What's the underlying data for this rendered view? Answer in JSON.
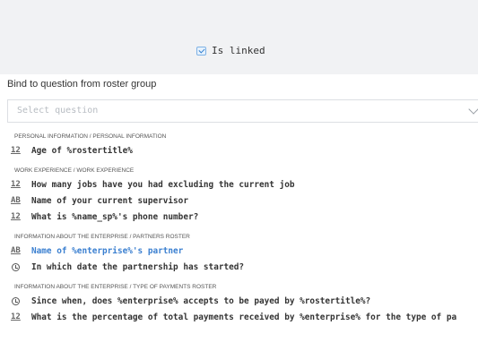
{
  "linked": {
    "label": "Is linked",
    "checked": true
  },
  "bind": {
    "label": "Bind to question from roster group"
  },
  "select": {
    "placeholder": "Select question"
  },
  "groups": [
    {
      "header": "PERSONAL INFORMATION / PERSONAL INFORMATION",
      "items": [
        {
          "icon": "numeric-icon",
          "glyph": "12",
          "text": "Age of %rostertitle%"
        }
      ]
    },
    {
      "header": "WORK EXPERIENCE / WORK EXPERIENCE",
      "items": [
        {
          "icon": "numeric-icon",
          "glyph": "12",
          "text": "How many jobs have you had excluding the current job"
        },
        {
          "icon": "text-icon",
          "glyph": "AB",
          "text": "Name of your current supervisor"
        },
        {
          "icon": "numeric-icon",
          "glyph": "12",
          "text": "What is %name_sp%'s phone number?"
        }
      ]
    },
    {
      "header": "INFORMATION ABOUT THE ENTERPRISE / PARTNERS ROSTER",
      "items": [
        {
          "icon": "text-icon",
          "glyph": "AB",
          "text": "Name of %enterprise%'s partner",
          "highlighted": true
        },
        {
          "icon": "date-icon",
          "glyph": "",
          "text": "In which date the partnership has started?"
        }
      ]
    },
    {
      "header": "INFORMATION ABOUT THE ENTERPRISE / TYPE OF PAYMENTS ROSTER",
      "items": [
        {
          "icon": "date-icon",
          "glyph": "",
          "text": "Since when, does %enterprise% accepts to be payed by %rostertitle%?"
        },
        {
          "icon": "numeric-icon",
          "glyph": "12",
          "text": "What is the percentage of total payments received by %enterprise% for the type of pa"
        }
      ]
    }
  ]
}
